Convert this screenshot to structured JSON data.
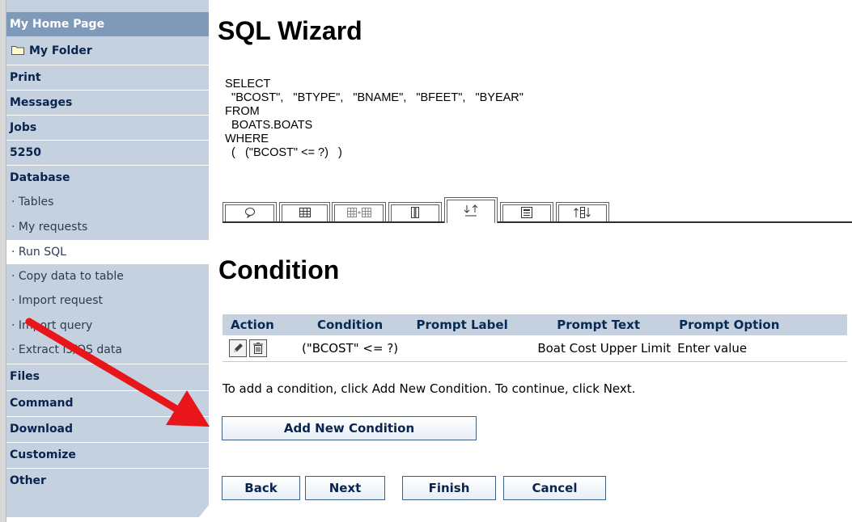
{
  "sidebar": {
    "home": "My Home Page",
    "folder": "My Folder",
    "print": "Print",
    "messages": "Messages",
    "jobs": "Jobs",
    "s5250": "5250",
    "database": "Database",
    "db_items": [
      "Tables",
      "My requests",
      "Run SQL",
      "Copy data to table",
      "Import request",
      "Import query",
      "Extract i5/OS data"
    ],
    "files": "Files",
    "command": "Command",
    "download": "Download",
    "customize": "Customize",
    "other": "Other",
    "bullet": "·"
  },
  "main": {
    "title": "SQL Wizard",
    "sql_lines": [
      "SELECT",
      "  \"BCOST\",   \"BTYPE\",   \"BNAME\",   \"BFEET\",   \"BYEAR\"",
      "FROM",
      "  BOATS.BOATS",
      "WHERE",
      "  (   (\"BCOST\" <= ?)   )"
    ],
    "section_title": "Condition",
    "table": {
      "headers": [
        "Action",
        "Condition",
        "Prompt Label",
        "Prompt Text",
        "Prompt Option"
      ],
      "rows": [
        {
          "condition": "(\"BCOST\" <= ?)",
          "prompt_label": "",
          "prompt_text": "Boat Cost Upper Limit",
          "prompt_option": "Enter value"
        }
      ]
    },
    "help_text": "To add a condition, click Add New Condition. To continue, click Next.",
    "add_button": "Add New Condition",
    "nav_buttons": {
      "back": "Back",
      "next": "Next",
      "finish": "Finish",
      "cancel": "Cancel"
    }
  },
  "colors": {
    "sidebar_bg": "#c5d1df",
    "sidebar_header": "#7f9ab9",
    "link": "#08244f",
    "arrow": "#e8161b"
  },
  "icons": [
    "folder-icon",
    "speech-bubble-icon",
    "table-icon",
    "join-tables-icon",
    "column-icon",
    "sort-icon",
    "summary-icon",
    "order-icon",
    "edit-icon",
    "trash-icon",
    "arrow-annotation"
  ]
}
